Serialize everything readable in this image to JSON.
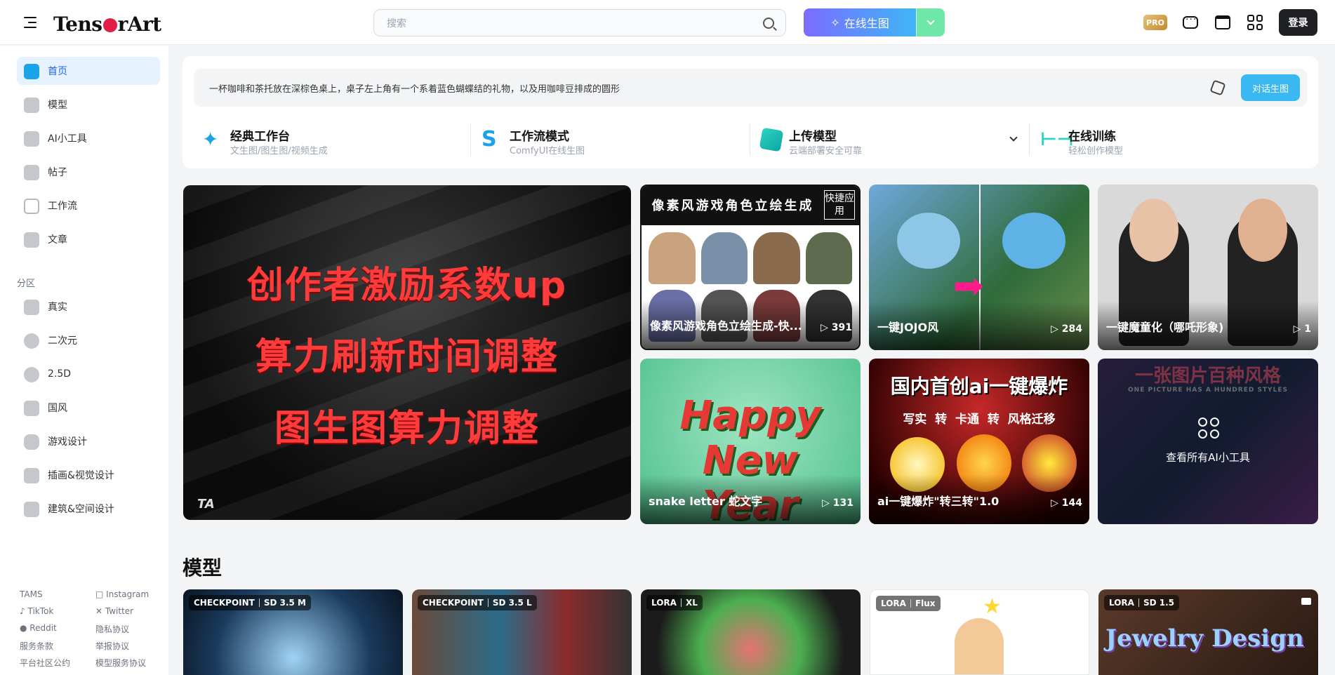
{
  "header": {
    "logo": "TensorArt",
    "search_placeholder": "搜索",
    "generate_label": "在线生图",
    "pro_label": "PRO",
    "login_label": "登录"
  },
  "sidebar": {
    "items": [
      {
        "label": "首页",
        "active": true
      },
      {
        "label": "模型"
      },
      {
        "label": "AI小工具"
      },
      {
        "label": "帖子"
      },
      {
        "label": "工作流"
      },
      {
        "label": "文章"
      }
    ],
    "section_label": "分区",
    "sections": [
      {
        "label": "真实"
      },
      {
        "label": "二次元"
      },
      {
        "label": "2.5D"
      },
      {
        "label": "国风"
      },
      {
        "label": "游戏设计"
      },
      {
        "label": "插画&视觉设计"
      },
      {
        "label": "建筑&空间设计"
      }
    ],
    "footer": {
      "tams": "TAMS",
      "instagram": "Instagram",
      "tiktok": "TikTok",
      "twitter": "Twitter",
      "reddit": "Reddit",
      "privacy": "隐私协议",
      "terms": "服务条款",
      "report": "举报协议",
      "community": "平台社区公约",
      "model_terms": "模型服务协议"
    }
  },
  "prompt": {
    "text": "一杯咖啡和茶托放在深棕色桌上，桌子左上角有一个系着蓝色蝴蝶结的礼物，以及用咖啡豆排成的圆形",
    "button": "对话生图"
  },
  "tools": [
    {
      "title": "经典工作台",
      "subtitle": "文生图/图生图/视频生成"
    },
    {
      "title": "工作流模式",
      "subtitle": "ComfyUI在线生图"
    },
    {
      "title": "上传模型",
      "subtitle": "云端部署安全可靠"
    },
    {
      "title": "在线训练",
      "subtitle": "轻松创作模型"
    }
  ],
  "banner": {
    "lines": [
      "创作者激励系数up",
      "算力刷新时间调整",
      "图生图算力调整"
    ],
    "mark": "TA"
  },
  "tiles": [
    {
      "title": "像素风游戏角色立绘生成",
      "badge": "快捷应用",
      "label": "像素风游戏角色立绘生成-快...",
      "count": "▷ 391"
    },
    {
      "label": "一键JOJO风",
      "count": "▷ 284"
    },
    {
      "label": "一键魔童化（哪吒形象)",
      "count": "▷ 1"
    },
    {
      "title": "Happy New Year",
      "label": "snake letter   蛇文字",
      "count": "▷ 131"
    },
    {
      "title": "国内首创ai一键爆炸",
      "subtitle": "写实  转  卡通  转  风格迁移",
      "label": "ai一键爆炸\"转三转\"1.0",
      "count": "▷ 144"
    },
    {
      "title": "一张图片百种风格",
      "subtitle": "ONE PICTURE HAS A HUNDRED STYLES",
      "label": "查看所有AI小工具"
    }
  ],
  "models_section": {
    "title": "模型",
    "cards": [
      {
        "type": "CHECKPOINT",
        "base": "SD 3.5 M"
      },
      {
        "type": "CHECKPOINT",
        "base": "SD 3.5 L"
      },
      {
        "type": "LORA",
        "base": "XL"
      },
      {
        "type": "LORA",
        "base": "Flux"
      },
      {
        "type": "LORA",
        "base": "SD 1.5",
        "art_text": "Jewelry Design"
      }
    ]
  }
}
